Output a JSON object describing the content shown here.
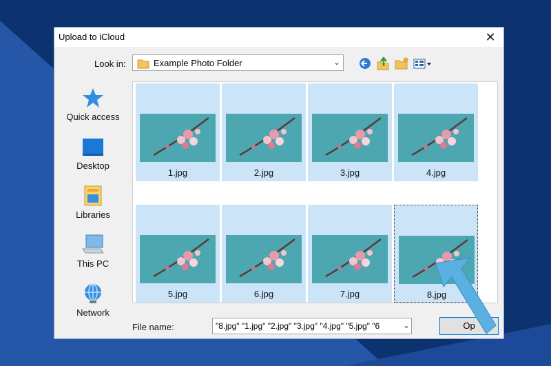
{
  "window": {
    "title": "Upload to iCloud"
  },
  "toolbar": {
    "look_in_label": "Look in:",
    "look_in_value": "Example Photo Folder",
    "back_icon": "back-arrow-icon",
    "up_icon": "up-folder-icon",
    "new_folder_icon": "new-folder-icon",
    "view_icon": "view-menu-icon"
  },
  "sidebar": {
    "items": [
      {
        "label": "Quick access",
        "icon": "star-icon"
      },
      {
        "label": "Desktop",
        "icon": "desktop-icon"
      },
      {
        "label": "Libraries",
        "icon": "libraries-icon"
      },
      {
        "label": "This PC",
        "icon": "computer-icon"
      },
      {
        "label": "Network",
        "icon": "network-icon"
      }
    ]
  },
  "files": [
    {
      "name": "1.jpg"
    },
    {
      "name": "2.jpg"
    },
    {
      "name": "3.jpg"
    },
    {
      "name": "4.jpg"
    },
    {
      "name": "5.jpg"
    },
    {
      "name": "6.jpg"
    },
    {
      "name": "7.jpg"
    },
    {
      "name": "8.jpg"
    }
  ],
  "footer": {
    "file_name_label": "File name:",
    "file_name_value": "\"8.jpg\" \"1.jpg\" \"2.jpg\" \"3.jpg\" \"4.jpg\" \"5.jpg\" \"6",
    "open_label": "Op"
  },
  "colors": {
    "background": "#0d3270",
    "stripe": "#2a5cb0",
    "selection": "#cce4f7",
    "arrow": "#5ab0e0"
  }
}
